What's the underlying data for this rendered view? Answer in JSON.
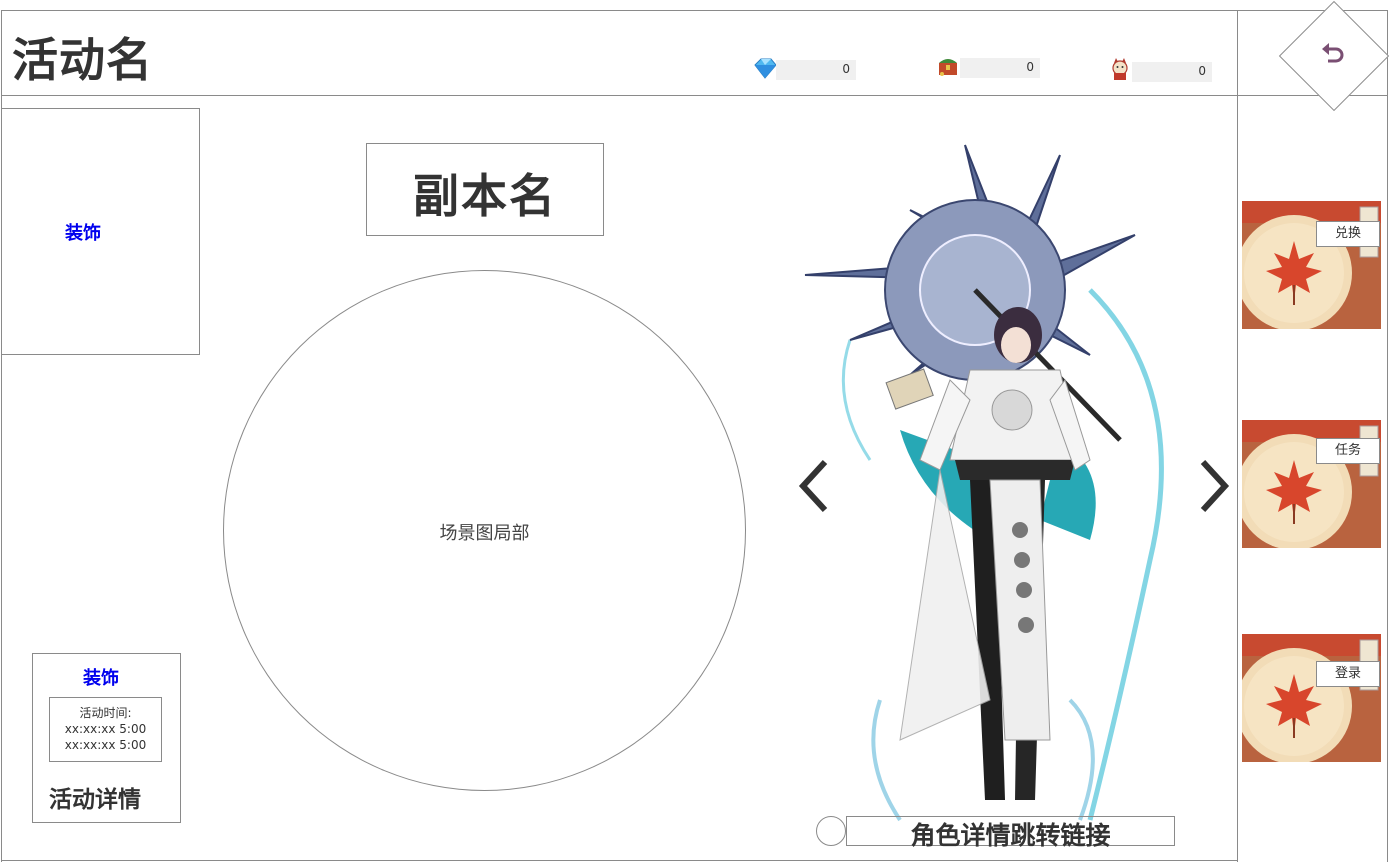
{
  "header": {
    "title": "活动名",
    "currencies": [
      {
        "icon": "diamond-icon",
        "value": "0"
      },
      {
        "icon": "treasure-chest-icon",
        "value": "0"
      },
      {
        "icon": "lucky-cat-icon",
        "value": "0"
      }
    ]
  },
  "back_button": {
    "icon": "return-arrow-icon"
  },
  "side_buttons": [
    {
      "label": "兑换",
      "icon": "maple-leaf-icon"
    },
    {
      "label": "任务",
      "icon": "maple-leaf-icon"
    },
    {
      "label": "登录",
      "icon": "maple-leaf-icon"
    }
  ],
  "left_panel": {
    "decoration_label": "装饰",
    "detail": {
      "decoration_label": "装饰",
      "time_label": "活动时间:",
      "time_start": "xx:xx:xx 5:00",
      "time_end": "xx:xx:xx 5:00",
      "link": "活动详情"
    }
  },
  "center": {
    "dungeon_name": "副本名",
    "scene_label": "场景图局部"
  },
  "character": {
    "link_label": "角色详情跳转链接",
    "prev_icon": "chevron-left-icon",
    "next_icon": "chevron-right-icon"
  },
  "colors": {
    "border": "#8a8a8a",
    "decoration_text": "#0000ee",
    "accent_purple": "#7a4f73"
  }
}
